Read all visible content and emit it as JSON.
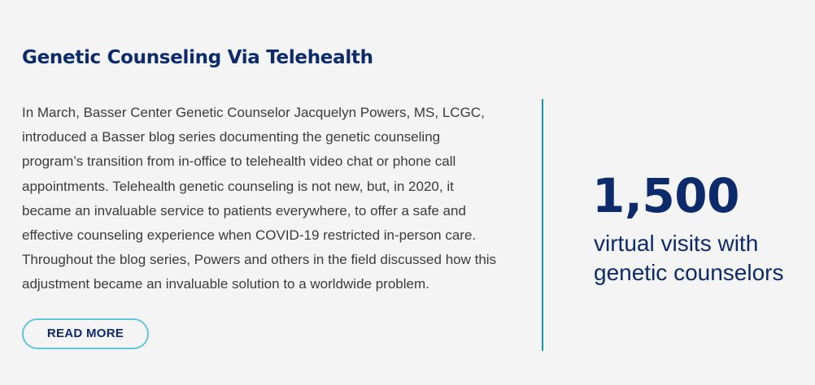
{
  "article": {
    "title": "Genetic Counseling Via Telehealth",
    "body_lines": [
      "In March, Basser Center Genetic Counselor Jacquelyn Powers, MS, LCGC,",
      "introduced a Basser blog series documenting the genetic counseling",
      "program’s transition from in-office to telehealth video chat or phone call",
      "appointments. Telehealth genetic counseling is not new, but, in 2020, it",
      "became an invaluable service to patients everywhere, to offer a safe and",
      "effective counseling experience when COVID-19 restricted in-person care.",
      "Throughout the blog series, Powers and others in the field discussed how this",
      "adjustment became an invaluable solution to a worldwide problem."
    ],
    "read_more_label": "READ MORE"
  },
  "stat": {
    "number": "1,500",
    "caption_lines": [
      "virtual visits with",
      "genetic counselors"
    ]
  },
  "colors": {
    "background": "#f4f4f4",
    "heading": "#0d2b6b",
    "body_text": "#3b3b3b",
    "button_border": "#5fc7da",
    "divider": "#1f8fa8"
  }
}
